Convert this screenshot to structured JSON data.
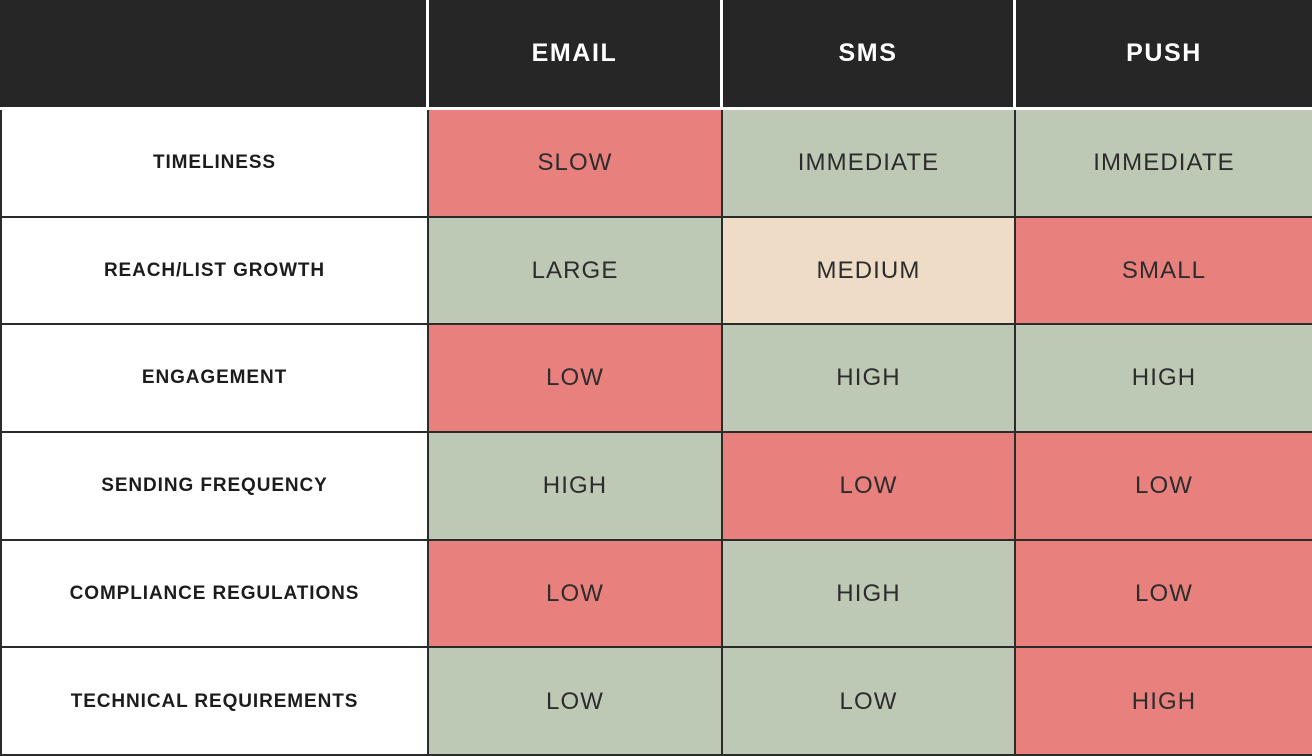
{
  "table": {
    "corner_label": "",
    "columns": [
      {
        "id": "email",
        "label": "EMAIL"
      },
      {
        "id": "sms",
        "label": "SMS"
      },
      {
        "id": "push",
        "label": "PUSH"
      }
    ],
    "rows": [
      {
        "label": "TIMELINESS",
        "cells": [
          {
            "value": "SLOW",
            "rating": "negative"
          },
          {
            "value": "IMMEDIATE",
            "rating": "positive"
          },
          {
            "value": "IMMEDIATE",
            "rating": "positive"
          }
        ]
      },
      {
        "label": "REACH/LIST GROWTH",
        "cells": [
          {
            "value": "LARGE",
            "rating": "positive"
          },
          {
            "value": "MEDIUM",
            "rating": "neutral"
          },
          {
            "value": "SMALL",
            "rating": "negative"
          }
        ]
      },
      {
        "label": "ENGAGEMENT",
        "cells": [
          {
            "value": "LOW",
            "rating": "negative"
          },
          {
            "value": "HIGH",
            "rating": "positive"
          },
          {
            "value": "HIGH",
            "rating": "positive"
          }
        ]
      },
      {
        "label": "SENDING FREQUENCY",
        "cells": [
          {
            "value": "HIGH",
            "rating": "positive"
          },
          {
            "value": "LOW",
            "rating": "negative"
          },
          {
            "value": "LOW",
            "rating": "negative"
          }
        ]
      },
      {
        "label": "COMPLIANCE REGULATIONS",
        "cells": [
          {
            "value": "LOW",
            "rating": "negative"
          },
          {
            "value": "HIGH",
            "rating": "positive"
          },
          {
            "value": "LOW",
            "rating": "negative"
          }
        ]
      },
      {
        "label": "TECHNICAL REQUIREMENTS",
        "cells": [
          {
            "value": "LOW",
            "rating": "positive"
          },
          {
            "value": "LOW",
            "rating": "positive"
          },
          {
            "value": "HIGH",
            "rating": "negative"
          }
        ]
      }
    ]
  },
  "colors": {
    "header_background": "#262626",
    "header_text": "#ffffff",
    "label_background": "#ffffff",
    "label_text": "#1c1c1c",
    "rating_negative": "#E8817D",
    "rating_positive": "#BDC9B5",
    "rating_neutral": "#EEDCC7",
    "gridline": "#2b2b2b",
    "cell_text": "#2c2c2c"
  }
}
